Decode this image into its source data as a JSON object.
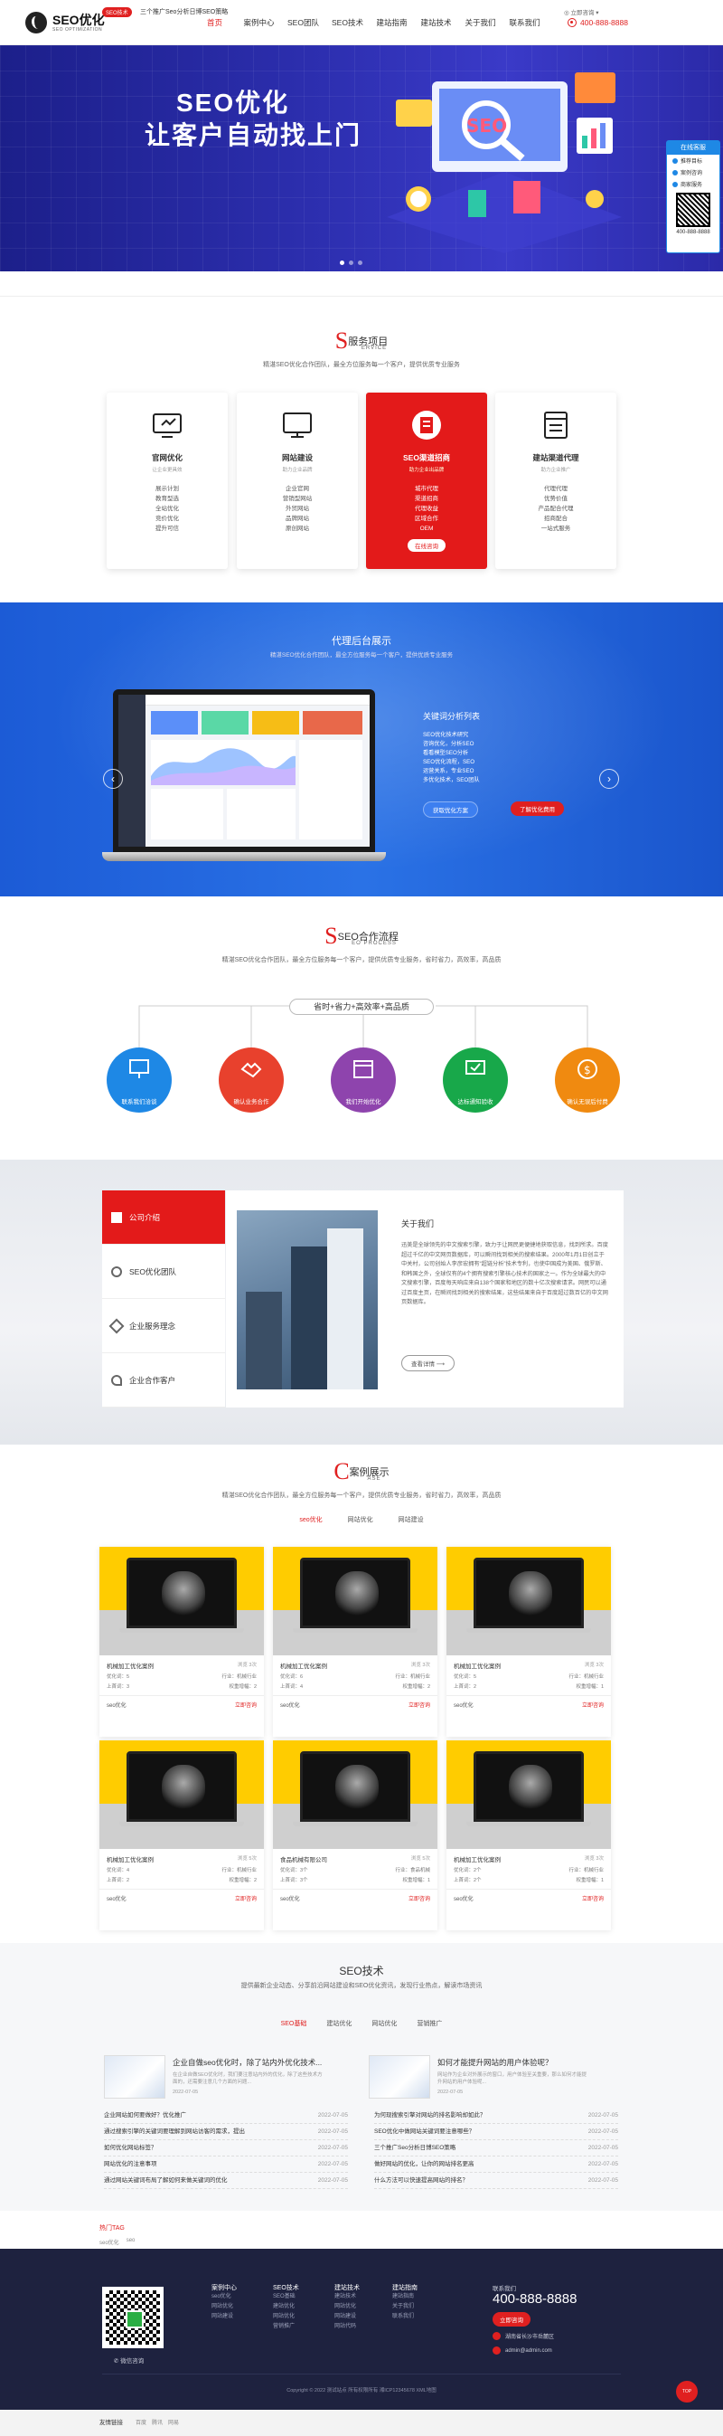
{
  "header": {
    "logo_title": "SEO优化",
    "logo_sub": "SEO OPTIMIZATION",
    "nav": [
      "首页",
      "案例中心",
      "SEO团队",
      "SEO技术",
      "建站指南",
      "建站技术",
      "关于我们",
      "联系我们"
    ],
    "phone": "400-888-8888"
  },
  "banner": {
    "line1": "SEO优化",
    "line2": "让客户自动找上门"
  },
  "service_widget": {
    "title": "在线客服",
    "items": [
      "推荐目标",
      "案例咨询",
      "商家服务"
    ],
    "phone_label": "400-888-8888"
  },
  "newsbar": {
    "tag": "SEO技术",
    "text": "三个推广Seo分析日博SEO策略",
    "more": "立即咨询"
  },
  "services": {
    "initial": "S",
    "title": "服务项目",
    "en": "ERVICE",
    "desc": "精湛SEO优化合作团队，最全方位服务每一个客户，提供优质专业服务",
    "cards": [
      {
        "title": "官网优化",
        "sub": "让企业更具效",
        "items": [
          "展示计划",
          "教育型选",
          "全站优化",
          "竞价优化",
          "提升可信"
        ]
      },
      {
        "title": "网站建设",
        "sub": "助力企业品牌",
        "items": [
          "企业官网",
          "营销型网站",
          "外贸网站",
          "品牌网站",
          "原创网站"
        ]
      },
      {
        "title": "SEO渠道招商",
        "sub": "助力企业出品牌",
        "items": [
          "城市代理",
          "渠道招商",
          "代理收益",
          "区域合作",
          "OEM"
        ],
        "button": "在线咨询"
      },
      {
        "title": "建站渠道代理",
        "sub": "助力企业推广",
        "items": [
          "代理代理",
          "优势价值",
          "产品配合代理",
          "招商配合",
          "一站式服务"
        ]
      }
    ]
  },
  "agent": {
    "title": "代理后台展示",
    "desc": "精湛SEO优化合作团队，最全方位服务每一个客户，提供优质专业服务",
    "info_title": "关键词分析列表",
    "info_lines": [
      "SEO优化技术研究",
      "咨询优化，分析SEO",
      "看看模型SEO分析",
      "SEO优化流程，SEO",
      "运营关系，专业SEO",
      "多优化技术，SEO团队"
    ],
    "btn1": "获取优化方案",
    "btn2": "了解优化费用"
  },
  "process": {
    "initial": "S",
    "title": "SEO合作流程",
    "en": "EO PROCESS",
    "desc": "精湛SEO优化合作团队，最全方位服务每一个客户，提供优质专业服务，省时省力，高效率，高品质",
    "bar": "省时+省力+高效率+高品质",
    "steps": [
      {
        "label": "联系我们洽谈",
        "color": "#1e88e5"
      },
      {
        "label": "确认业务合作",
        "color": "#e8412d"
      },
      {
        "label": "我们开始优化",
        "color": "#8e44ad"
      },
      {
        "label": "达标通知验收",
        "color": "#18a84a"
      },
      {
        "label": "确认无误后付费",
        "color": "#f08a10"
      }
    ]
  },
  "about": {
    "menu": [
      "公司介绍",
      "SEO优化团队",
      "企业服务理念",
      "企业合作客户"
    ],
    "heading": "关于我们",
    "text": "迅美是全球领先的中文搜索引擎，致力于让网民更便捷地获取信息，找到所求。百度超过千亿的中文网页数据库，可以瞬间找到相关的搜索结果。2000年1月1日创立于中关村，公司创始人李彦宏拥有“超链分析”技术专利，也使中国成为美国、俄罗斯、和韩国之外，全球仅有的4个拥有搜索引擎核心技术的国家之一。作为全球最大的中文搜索引擎，百度每天响应来自138个国家和地区的数十亿次搜索请求。网民可以通过百度主页，在瞬间找到相关的搜索结果，这些结果来自于百度超过数百亿的中文网页数据库。",
    "more": "查看详情"
  },
  "cases": {
    "initial": "C",
    "title": "案例展示",
    "en": "ASE",
    "desc": "精湛SEO优化合作团队，最全方位服务每一个客户，提供优质专业服务，省时省力，高效率，高品质",
    "tabs": [
      "seo优化",
      "网站优化",
      "网站建设"
    ],
    "items": [
      {
        "name": "机械加工优化案例",
        "hits": "浏览 3次",
        "a": "优化词：5",
        "b": "行业：机械行业",
        "c": "上首词：3",
        "d": "权重增幅：2",
        "tag": "seo优化",
        "q": "立即咨询"
      },
      {
        "name": "机械加工优化案例",
        "hits": "浏览 3次",
        "a": "优化词：6",
        "b": "行业：机械行业",
        "c": "上首词：4",
        "d": "权重增幅：2",
        "tag": "seo优化",
        "q": "立即咨询"
      },
      {
        "name": "机械加工优化案例",
        "hits": "浏览 3次",
        "a": "优化词：5",
        "b": "行业：机械行业",
        "c": "上首词：2",
        "d": "权重增幅：1",
        "tag": "seo优化",
        "q": "立即咨询"
      },
      {
        "name": "机械加工优化案例",
        "hits": "浏览 5次",
        "a": "优化词：4",
        "b": "行业：机械行业",
        "c": "上首词：2",
        "d": "权重增幅：2",
        "tag": "seo优化",
        "q": "立即咨询"
      },
      {
        "name": "食品机械有限公司",
        "hits": "浏览 5次",
        "a": "优化词：3个",
        "b": "行业：食品机械",
        "c": "上首词：3个",
        "d": "权重增幅：1",
        "tag": "seo优化",
        "q": "立即咨询"
      },
      {
        "name": "机械加工优化案例",
        "hits": "浏览 3次",
        "a": "优化词：2个",
        "b": "行业：机械行业",
        "c": "上首词：2个",
        "d": "权重增幅：1",
        "tag": "seo优化",
        "q": "立即咨询"
      }
    ]
  },
  "tech": {
    "title": "SEO技术",
    "desc": "提供最新企业动态、分享前沿网站建设和SEO优化资讯，发现行业热点，解读市场资讯",
    "tabs": [
      "SEO基础",
      "建站优化",
      "网站优化",
      "营销推广"
    ],
    "featured": [
      {
        "title": "企业自做seo优化时，除了站内外优化技术...",
        "text": "在企业自做SEO优化时，我们要注意站内外的优化，除了这些技术方面的，还需要注意几个方面的问题...",
        "date": "2022-07-05"
      },
      {
        "title": "如何才能提升网站的用户体验呢？",
        "text": "网站作为企业对外展示的窗口，用户体验至关重要，那么如何才能提升网站的用户体验呢...",
        "date": "2022-07-05"
      }
    ],
    "left": [
      {
        "t": "企业网站如何要做好？优化推广",
        "d": "2022-07-05"
      },
      {
        "t": "通过搜索引擎的关键词要理解到网站访客的需求，提出",
        "d": "2022-07-05"
      },
      {
        "t": "如何优化网站标签？",
        "d": "2022-07-05"
      },
      {
        "t": "网站优化的注意事项",
        "d": "2022-07-05"
      },
      {
        "t": "通过网站关键词布局了解如何来做关键词的优化",
        "d": "2022-07-05"
      }
    ],
    "right": [
      {
        "t": "为何现搜索引擎对网站的排名影响却如此？",
        "d": "2022-07-05"
      },
      {
        "t": "SEO优化中做网站关键词要注意哪些？",
        "d": "2022-07-05"
      },
      {
        "t": "三个推广Seo分析日博SEO策略",
        "d": "2022-07-05"
      },
      {
        "t": "做好网站的优化，让你的网站排名更高",
        "d": "2022-07-05"
      },
      {
        "t": "什么方法可以快速提高网站的排名？",
        "d": "2022-07-05"
      }
    ]
  },
  "links": {
    "title": "热门TAG",
    "items": [
      "seo优化",
      "seo"
    ]
  },
  "footer": {
    "qr_label": "微信咨询",
    "cols": [
      {
        "h": "案例中心",
        "items": [
          "seo优化",
          "网站优化",
          "网站建设"
        ]
      },
      {
        "h": "SEO技术",
        "items": [
          "SEO基础",
          "建站优化",
          "网站优化",
          "营销推广"
        ]
      },
      {
        "h": "建站技术",
        "items": [
          "建站技术",
          "网站优化",
          "网站建设",
          "网站代码"
        ]
      },
      {
        "h": "建站指南",
        "items": [
          "建站指南",
          "关于我们",
          "联系我们"
        ]
      }
    ],
    "tel_label": "联系我们",
    "tel": "400-888-8888",
    "btn": "立即咨询",
    "addr": "湖南省长沙市岳麓区",
    "mail": "admin@admin.com",
    "copyright": "Copyright © 2022 测试站点 所有权限所有 湘ICP12345678  XML地图",
    "totop": "TOP",
    "bottom_title": "友情链接",
    "bottom_items": [
      "百度",
      "腾讯",
      "网易"
    ]
  }
}
